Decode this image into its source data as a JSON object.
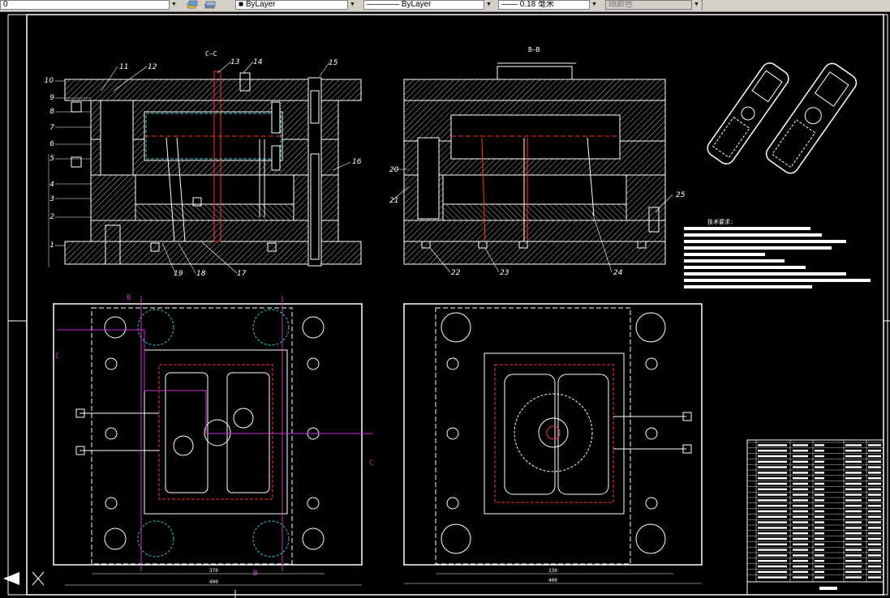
{
  "toolbar": {
    "layer_value": "0",
    "color_value": "ByLayer",
    "linetype_value": "ByLayer",
    "lineweight_value": "0.18 毫米",
    "plotstyle_value": "随颜色",
    "icons": [
      "layer-manager-icon",
      "layer-state-icon"
    ]
  },
  "drawing": {
    "section_cc_label": "C—C",
    "section_bb_label": "B—B",
    "tech_req_title": "技术要求:",
    "part_numbers": [
      "1",
      "2",
      "3",
      "4",
      "5",
      "6",
      "7",
      "8",
      "9",
      "10",
      "11",
      "12",
      "13",
      "14",
      "15",
      "16",
      "17",
      "18",
      "19",
      "20",
      "21",
      "22",
      "23",
      "24",
      "25"
    ],
    "dim_left_width": "370",
    "dim_left_total": "400",
    "dim_right_width": "330",
    "dim_right_total": "400",
    "cut_marks": {
      "b": "B",
      "c": "C"
    },
    "colors": {
      "background": "#000000",
      "lines": "#ffffff",
      "center": "#ff3333",
      "cyan": "#33cccc",
      "section": "#ff33ff"
    }
  }
}
